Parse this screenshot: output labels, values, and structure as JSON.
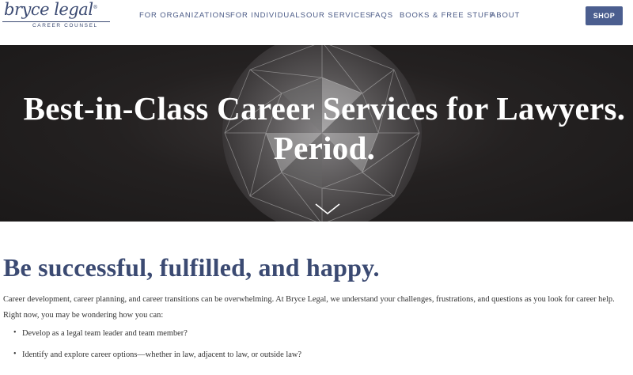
{
  "logo": {
    "script_text": "bryce legal",
    "registered": "®",
    "subtitle": "CAREER COUNSEL"
  },
  "nav": {
    "items": [
      {
        "label": "FOR ORGANIZATIONS"
      },
      {
        "label": "FOR INDIVIDUALS"
      },
      {
        "label": "OUR SERVICES"
      },
      {
        "label": "FAQS"
      },
      {
        "label": "BOOKS & FREE STUFF"
      },
      {
        "label": "ABOUT"
      }
    ],
    "shop_label": "SHOP"
  },
  "hero": {
    "title_line1": "Best-in-Class Career Services for Lawyers.",
    "title_line2": "Period.",
    "scroll_icon": "chevron-down-icon"
  },
  "main": {
    "heading": "Be successful, fulfilled, and happy.",
    "intro": "Career development, career planning, and career transitions can be overwhelming. At Bryce Legal, we understand your challenges, frustrations, and questions as you look for career help. Right now, you may be wondering how you can:",
    "bullets": [
      "Develop as a legal team leader and team member?",
      "Identify and explore career options—whether in law, adjacent to law, or outside law?"
    ]
  },
  "colors": {
    "brand": "#3b4a72",
    "nav_text": "#4a5a86",
    "shop_button": "#4b5e8f",
    "hero_bg": "#242121"
  }
}
